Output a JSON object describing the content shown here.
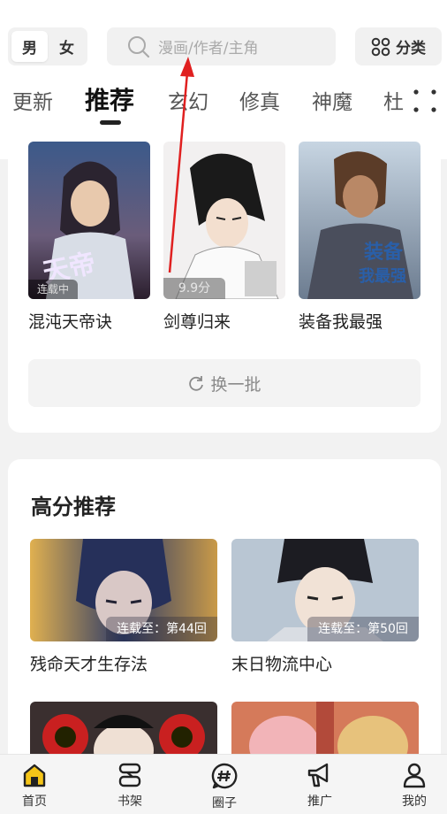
{
  "header": {
    "gender": {
      "male": "男",
      "female": "女"
    },
    "search_placeholder": "漫画/作者/主角",
    "category_label": "分类"
  },
  "tabs": [
    "更新",
    "推荐",
    "玄幻",
    "修真",
    "神魔",
    "杜"
  ],
  "recommend": {
    "items": [
      {
        "title": "混沌天帝诀",
        "badge": "连载中"
      },
      {
        "title": "剑尊归来",
        "score": "9.9分"
      },
      {
        "title": "装备我最强"
      }
    ],
    "swap_label": "换一批"
  },
  "high_score": {
    "title": "高分推荐",
    "items": [
      {
        "title": "残命天才生存法",
        "chapter": "连载至：第44回"
      },
      {
        "title": "末日物流中心",
        "chapter": "连载至：第50回"
      }
    ]
  },
  "bottom_nav": [
    "首页",
    "书架",
    "圈子",
    "推广",
    "我的"
  ],
  "colors": {
    "accent": "#f5c518",
    "annotation": "#e02020"
  }
}
